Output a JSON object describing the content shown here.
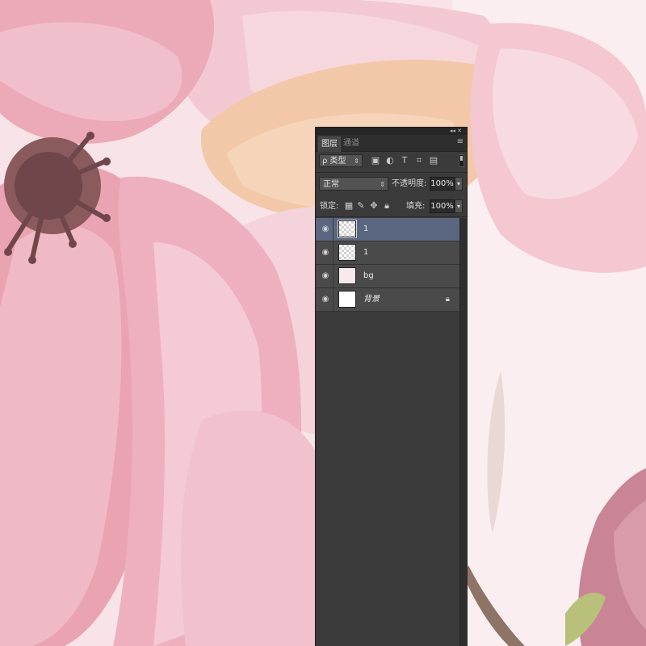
{
  "colors": {
    "panel_bg": "#3b3b3b",
    "selected_layer": "#5b6780",
    "petal_pink": "#f0b8c4",
    "petal_deep": "#e79aab",
    "peach": "#f2c6a6",
    "stamen": "#7a4f52"
  },
  "panel": {
    "collapse_control": "◂◂ ✕",
    "tabs": [
      {
        "label": "图层",
        "active": true
      },
      {
        "label": "通道",
        "active": false
      }
    ],
    "menu_icon": "hamburger-menu-icon",
    "filter": {
      "kind_label": "ρ 类型",
      "icons": [
        "image-filter-icon",
        "adjustment-filter-icon",
        "type-filter-icon",
        "shape-filter-icon",
        "smart-object-filter-icon"
      ]
    },
    "blend": {
      "mode": "正常",
      "opacity_label": "不透明度:",
      "opacity_value": "100%"
    },
    "lock": {
      "label": "锁定:",
      "icons": [
        "lock-transparent-icon",
        "lock-paint-icon",
        "lock-move-icon",
        "lock-all-icon"
      ],
      "fill_label": "填充:",
      "fill_value": "100%"
    },
    "layers": [
      {
        "name": "1",
        "visible": true,
        "selected": true,
        "thumb": "checker",
        "locked": false
      },
      {
        "name": "1",
        "visible": true,
        "selected": false,
        "thumb": "checker",
        "locked": false
      },
      {
        "name": "bg",
        "visible": true,
        "selected": false,
        "thumb": "pink",
        "locked": false
      },
      {
        "name": "背景",
        "visible": true,
        "selected": false,
        "thumb": "white",
        "locked": true
      }
    ]
  }
}
